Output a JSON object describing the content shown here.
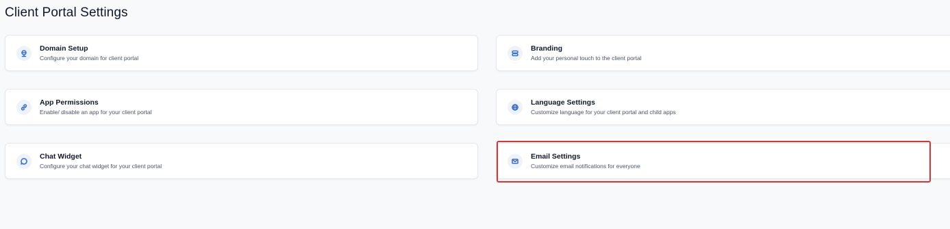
{
  "page": {
    "title": "Client Portal Settings"
  },
  "cards": {
    "domain": {
      "title": "Domain Setup",
      "desc": "Configure your domain for client portal",
      "icon": "globe-icon"
    },
    "branding": {
      "title": "Branding",
      "desc": "Add your personal touch to the client portal",
      "icon": "brush-icon"
    },
    "permissions": {
      "title": "App Permissions",
      "desc": "Enable/ disable an app for your client portal",
      "icon": "link-icon"
    },
    "language": {
      "title": "Language Settings",
      "desc": "Customize language for your client portal and child apps",
      "icon": "language-globe-icon"
    },
    "chat": {
      "title": "Chat Widget",
      "desc": "Configure your chat widget for your client portal",
      "icon": "chat-bubble-icon"
    },
    "email": {
      "title": "Email Settings",
      "desc": "Customize email notifications for everyone",
      "icon": "mail-icon"
    }
  },
  "colors": {
    "background": "#f8f9fb",
    "card": "#ffffff",
    "icon_accent": "#3b6fd8",
    "highlight": "#e03131"
  }
}
